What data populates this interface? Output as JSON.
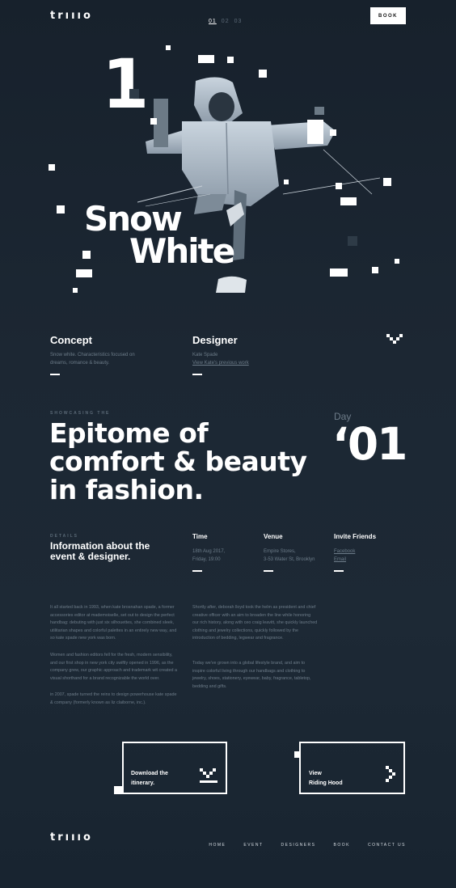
{
  "header": {
    "logo": "trıııo",
    "pager": [
      "01",
      "02",
      "03"
    ],
    "book_label": "BOOK"
  },
  "hero": {
    "number": "1",
    "title_line1": "Snow",
    "title_line2": "White"
  },
  "concept": {
    "title": "Concept",
    "text": "Snow white. Characteristics focused on dreams, romance & beauty."
  },
  "designer": {
    "title": "Designer",
    "name": "Kate Spade",
    "link": "View Kate's previous work"
  },
  "showcase": {
    "kicker": "SHOWCASING THE",
    "headline_line1": "Epitome of",
    "headline_line2": "comfort & beauty",
    "headline_line3": "in fashion.",
    "day_label": "Day",
    "day_number": "‘01"
  },
  "details": {
    "kicker": "DETAILS",
    "title_line1": "Information about the",
    "title_line2": "event & designer.",
    "time": {
      "label": "Time",
      "line1": "18th Aug 2017,",
      "line2": "Friday, 19:00"
    },
    "venue": {
      "label": "Venue",
      "line1": "Empire Stores,",
      "line2": "3-53 Water St, Brooklyn"
    },
    "invite": {
      "label": "Invite Friends",
      "link1": "Facebook",
      "link2": "Email"
    }
  },
  "body": {
    "left_p1": "It all started back in 1993, when kate brosnahan spade, a former accessories editor at mademoiselle, set out to design the perfect handbag: debuting with just six silhouettes, she combined sleek, utilitarian shapes and colorful palettes in an entirely new way, and so kate spade new york was born.",
    "left_p2": "Women and fashion editors fell for the fresh, modern sensibility, and our first shop in new york city swiftly opened in 1996, as the company grew, our graphic approach and trademark wit created a visual shorthand for a brand recognizable the world over.",
    "left_p3": "in 2007, spade turned the reins to design powerhouse kate spade & company (formerly known as liz claiborne, inc.).",
    "right_p1": "Shortly after, deborah lloyd took the helm as president and chief creative officer with an aim to broaden the line while honoring our rich history, along with ceo craig leavitt, she quickly launched clothing and jewelry collections, quickly followed by the introduction of bedding, legwear and fragrance.",
    "right_p2": "Today we've grown into a global lifestyle brand, and aim to inspire colorful living through our handbags and clothing to jewelry, shoes, stationery, eyewear, baby, fragrance, tabletop, bedding and gifts."
  },
  "cta": {
    "download_line1": "Download the",
    "download_line2": "itinerary.",
    "view_line1": "View",
    "view_line2": "Riding Hood"
  },
  "footer": {
    "logo": "trıııo",
    "nav": [
      "HOME",
      "EVENT",
      "DESIGNERS",
      "BOOK",
      "CONTACT US"
    ]
  }
}
